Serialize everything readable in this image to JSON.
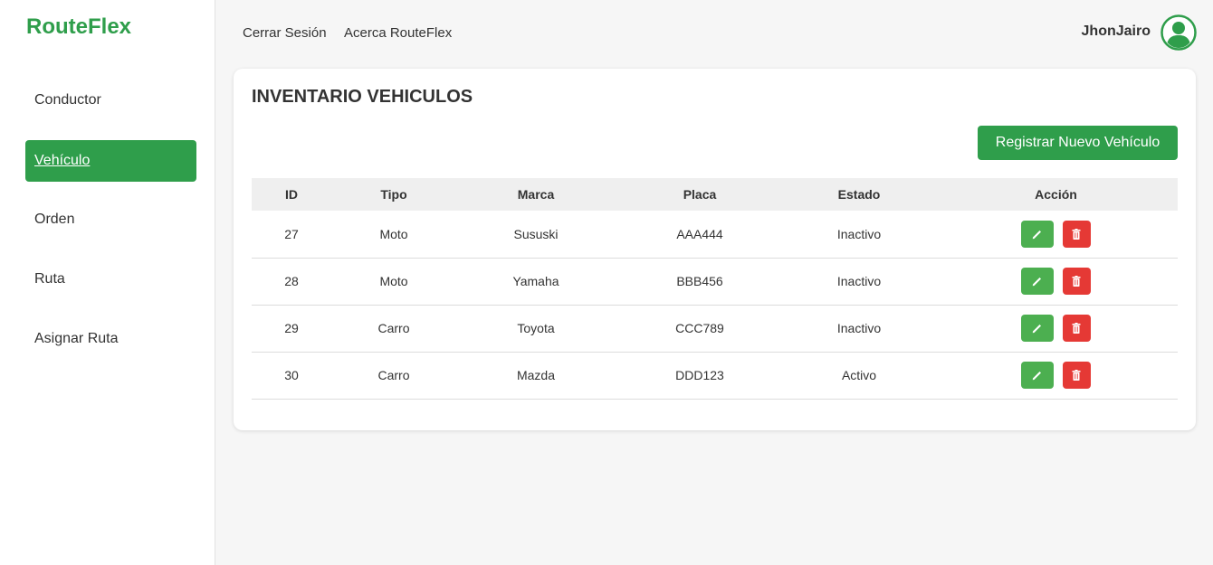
{
  "app": {
    "logo": "RouteFlex"
  },
  "sidebar": {
    "items": [
      {
        "label": "Conductor",
        "active": false
      },
      {
        "label": "Vehículo",
        "active": true
      },
      {
        "label": "Orden",
        "active": false
      },
      {
        "label": "Ruta",
        "active": false
      },
      {
        "label": "Asignar Ruta",
        "active": false
      }
    ]
  },
  "topbar": {
    "links": [
      "Cerrar Sesión",
      "Acerca RouteFlex"
    ],
    "user": "JhonJairo",
    "avatar_icon": "user-circle-icon"
  },
  "main": {
    "title": "INVENTARIO VEHICULOS",
    "register_button": "Registrar Nuevo Vehículo",
    "table": {
      "headers": [
        "ID",
        "Tipo",
        "Marca",
        "Placa",
        "Estado",
        "Acción"
      ],
      "rows": [
        [
          "27",
          "Moto",
          "Sususki",
          "AAA444",
          "Inactivo"
        ],
        [
          "28",
          "Moto",
          "Yamaha",
          "BBB456",
          "Inactivo"
        ],
        [
          "29",
          "Carro",
          "Toyota",
          "CCC789",
          "Inactivo"
        ],
        [
          "30",
          "Carro",
          "Mazda",
          "DDD123",
          "Activo"
        ]
      ],
      "row_actions": [
        "edit-icon",
        "trash-icon"
      ]
    }
  },
  "colors": {
    "brand": "#2f9e4b",
    "edit": "#4caf50",
    "delete": "#e53935"
  }
}
